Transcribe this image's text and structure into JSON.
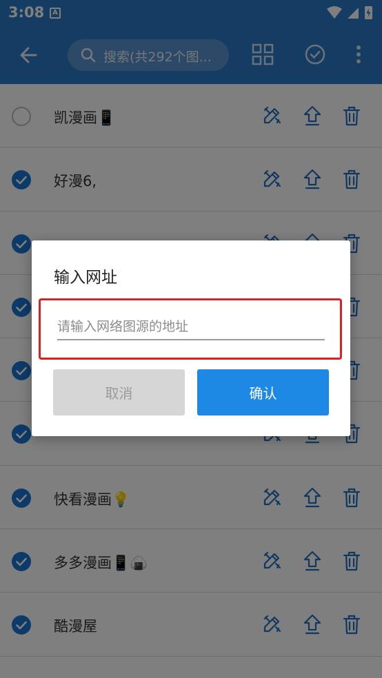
{
  "status_bar": {
    "time": "3:08",
    "notification_letter": "A"
  },
  "app_bar": {
    "search_placeholder": "搜索(共292个图..."
  },
  "list": [
    {
      "name": "凯漫画📱",
      "selected": false
    },
    {
      "name": "好漫6,",
      "selected": true
    },
    {
      "name": "",
      "selected": true
    },
    {
      "name": "",
      "selected": true
    },
    {
      "name": "",
      "selected": true
    },
    {
      "name": "",
      "selected": true
    },
    {
      "name": "快看漫画💡",
      "selected": true
    },
    {
      "name": "多多漫画📱🍙",
      "selected": true
    },
    {
      "name": "酷漫屋",
      "selected": true
    }
  ],
  "dialog": {
    "title": "输入网址",
    "input_placeholder": "请输入网络图源的地址",
    "input_value": "",
    "cancel_label": "取消",
    "confirm_label": "确认"
  },
  "colors": {
    "primary": "#2a78c4",
    "accent": "#1976d2",
    "highlight_border": "#e02020"
  },
  "icons": [
    "back-arrow-icon",
    "search-icon",
    "grid-icon",
    "check-circle-icon",
    "more-vert-icon",
    "edit-icon",
    "upload-icon",
    "trash-icon"
  ]
}
